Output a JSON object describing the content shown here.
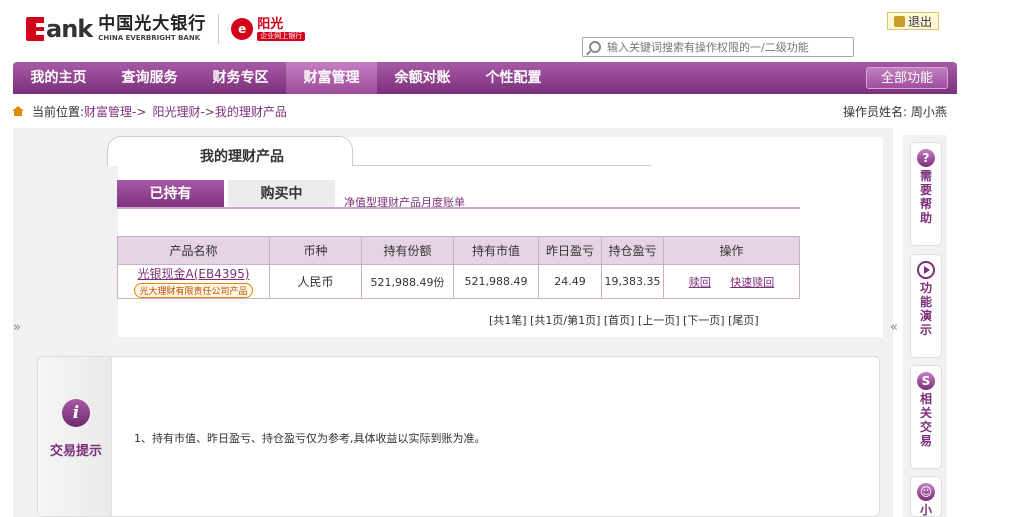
{
  "header": {
    "logo_ank": "ank",
    "logo_cn": "中国光大银行",
    "logo_en": "CHINA EVERBRIGHT BANK",
    "ygl_title": "阳光",
    "ygl_sub": "企业网上银行",
    "logout": "退出",
    "search_placeholder": "输入关键词搜索有操作权限的一/二级功能"
  },
  "nav": {
    "items": [
      {
        "label": "我的主页"
      },
      {
        "label": "查询服务"
      },
      {
        "label": "财务专区"
      },
      {
        "label": "财富管理"
      },
      {
        "label": "余额对账"
      },
      {
        "label": "个性配置"
      }
    ],
    "all": "全部功能",
    "active_index": 3
  },
  "breadcrumb": {
    "prefix": "当前位置:",
    "items": [
      "财富管理->",
      "阳光理财->我的理财产品"
    ]
  },
  "operator": "操作员姓名: 周小燕",
  "page": {
    "title": "我的理财产品",
    "tabs": [
      "已持有",
      "购买中"
    ],
    "bill_link": "净值型理财产品月度账单"
  },
  "table": {
    "headers": [
      "产品名称",
      "币种",
      "持有份额",
      "持有市值",
      "昨日盈亏",
      "持仓盈亏",
      "操作"
    ],
    "rows": [
      {
        "name": "光银现金A(EB4395)",
        "issuer": "光大理财有限责任公司产品",
        "currency": "人民币",
        "shares": "521,988.49份",
        "market_value": "521,988.49",
        "yesterday_pnl": "24.49",
        "position_pnl": "19,383.35",
        "ops": [
          "赎回",
          "快速赎回"
        ]
      }
    ]
  },
  "pager": "[共1笔] [共1页/第1页] [首页] [上一页] [下一页] [尾页]",
  "tips": {
    "label": "交易提示",
    "text": "1、持有市值、昨日盈亏、持仓盈亏仅为参考,具体收益以实际到账为准。"
  },
  "side": {
    "help": "需要帮助",
    "demo": "功能演示",
    "related": "相关交易",
    "more": "小"
  },
  "controls": {
    "expand": "»",
    "collapse": "«"
  },
  "colors": {
    "brand_purple": "#7c307b",
    "brand_red": "#d4001a"
  }
}
